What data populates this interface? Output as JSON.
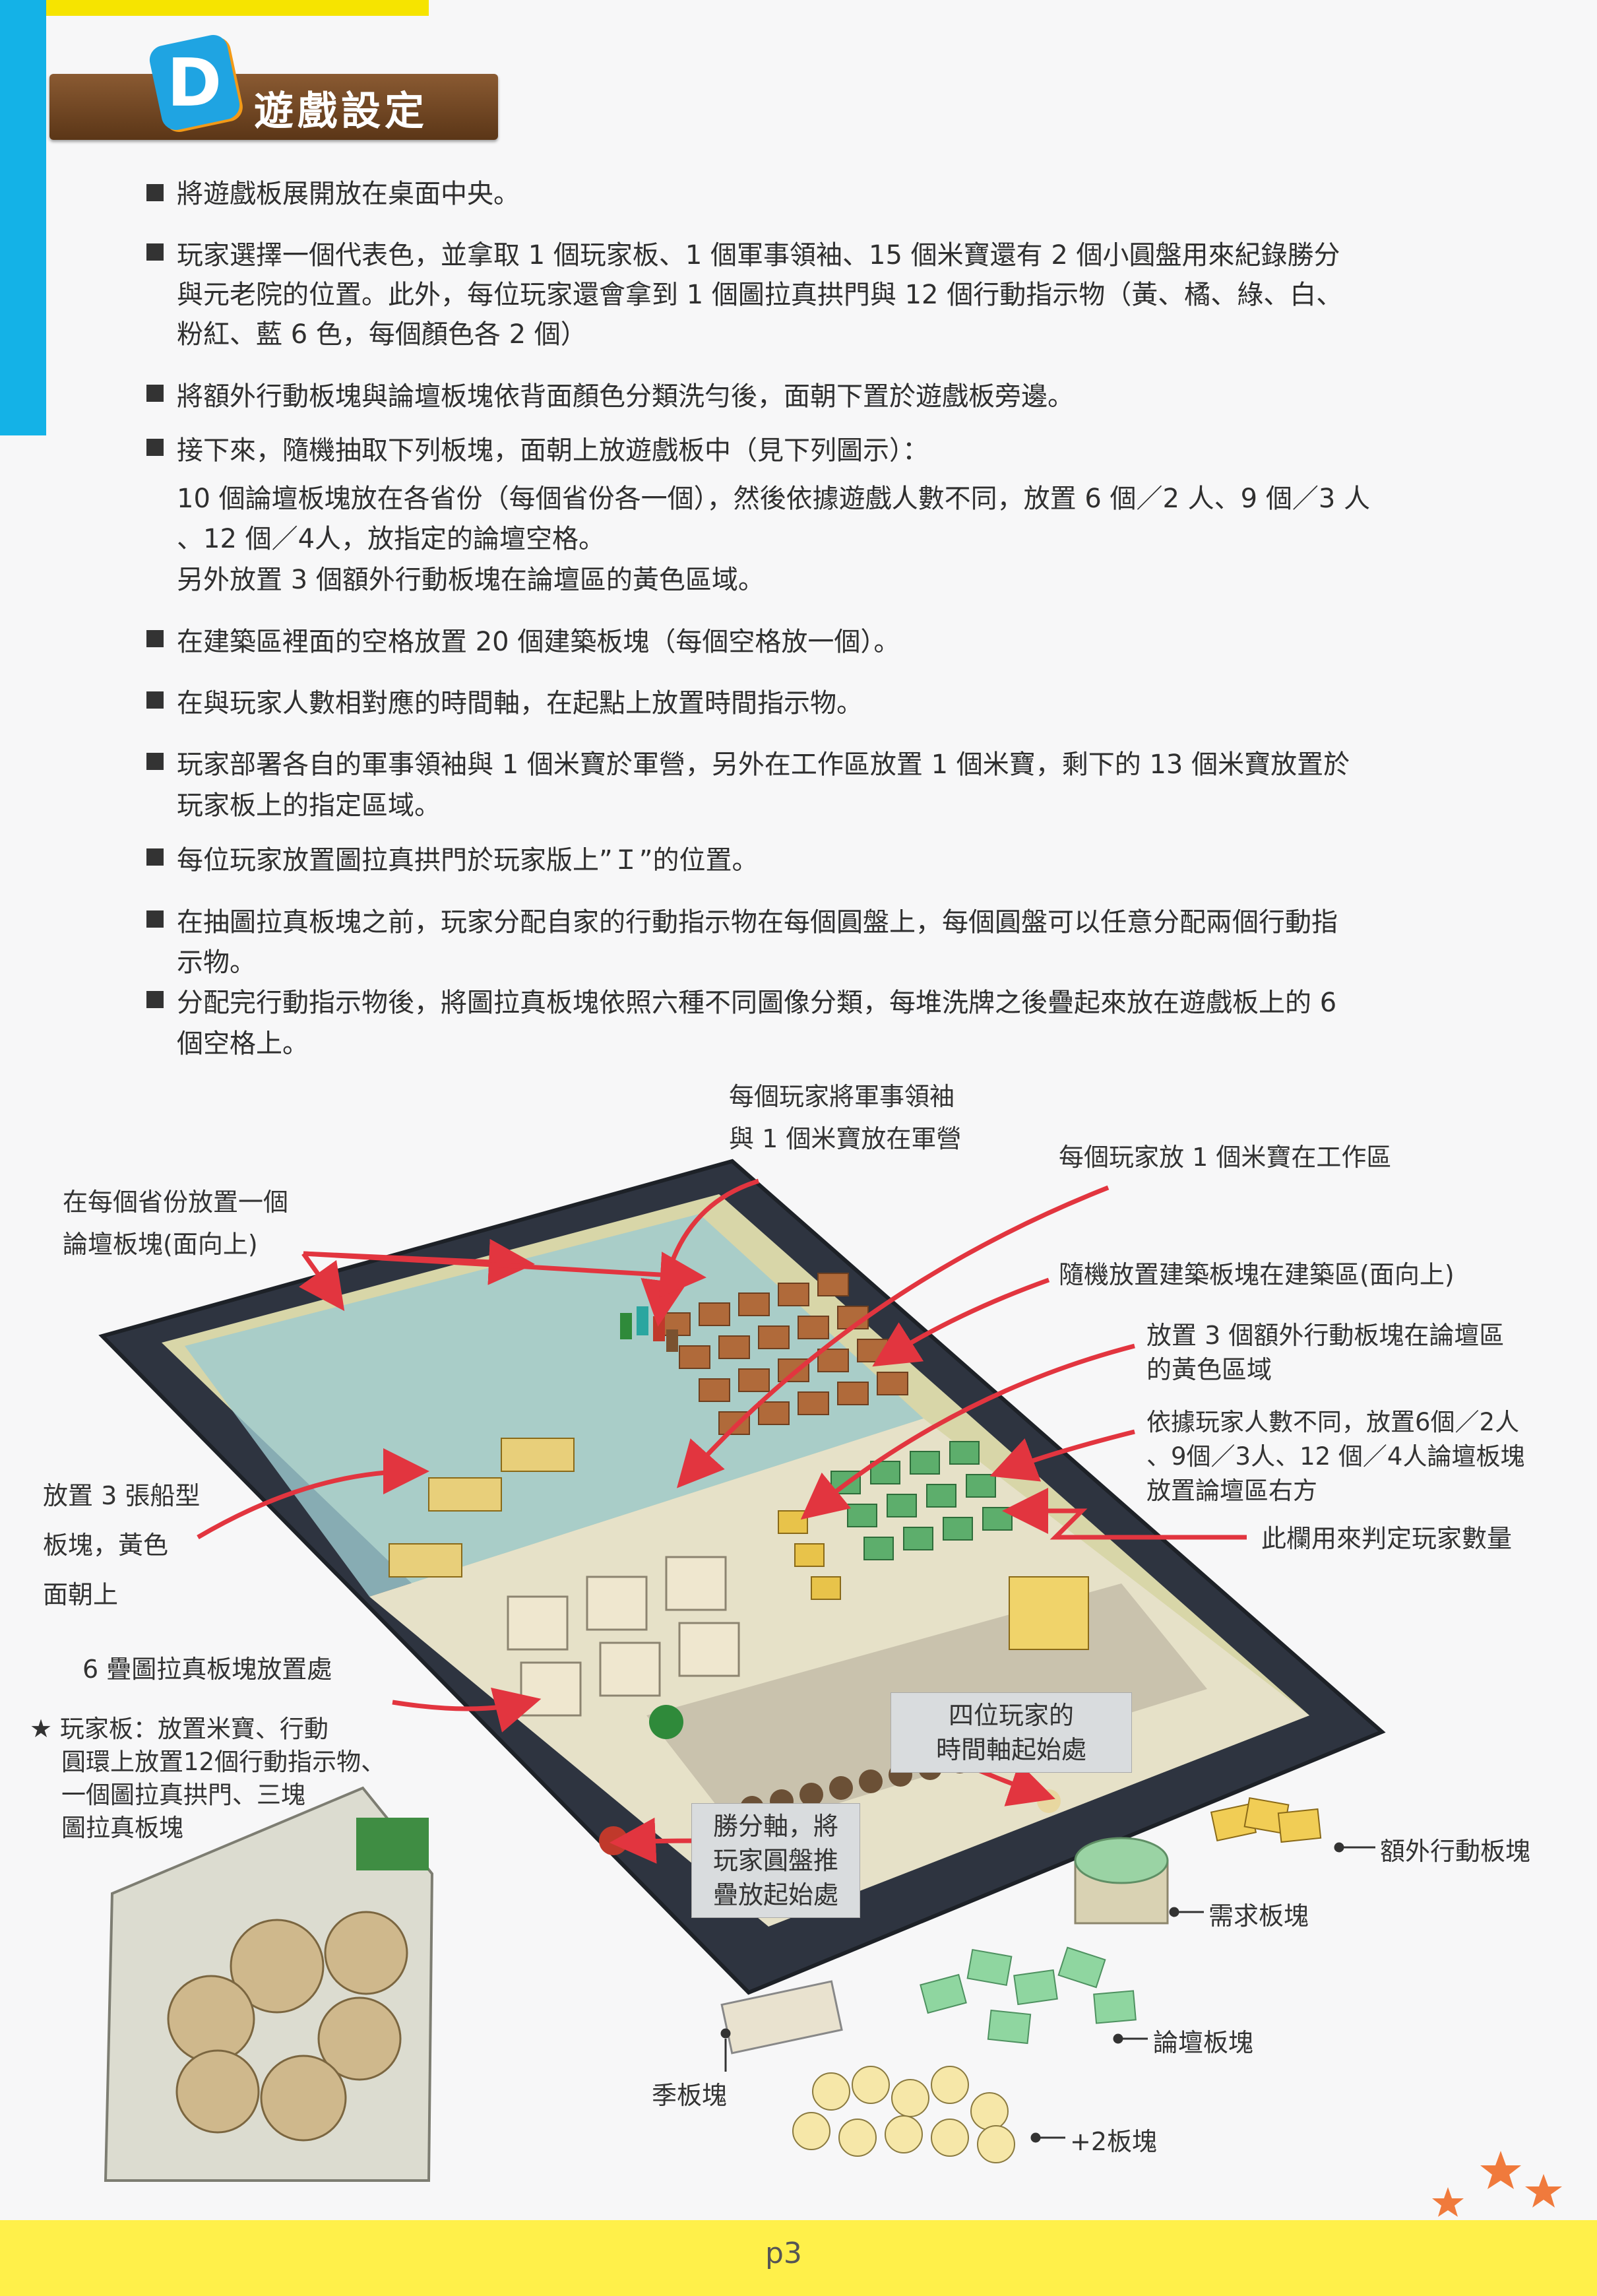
{
  "header": {
    "badge": "D",
    "title": "遊戲設定"
  },
  "bullets": [
    {
      "lines": [
        "將遊戲板展開放在桌面中央。"
      ]
    },
    {
      "lines": [
        "玩家選擇一個代表色，並拿取 1 個玩家板、1 個軍事領袖、15 個米寶還有 2 個小圓盤用來紀錄勝分",
        "與元老院的位置。此外，每位玩家還會拿到 1 個圖拉真拱門與 12 個行動指示物（黃、橘、綠、白、",
        "粉紅、藍 6 色，每個顏色各 2 個）"
      ]
    },
    {
      "lines": [
        "將額外行動板塊與論壇板塊依背面顏色分類洗勻後，面朝下置於遊戲板旁邊。"
      ]
    },
    {
      "lines": [
        "接下來，隨機抽取下列板塊，面朝上放遊戲板中（見下列圖示）：",
        "10 個論壇板塊放在各省份（每個省份各一個），然後依據遊戲人數不同，放置 6 個／2 人、9 個／3 人",
        "、12 個／4人，放指定的論壇空格。",
        "另外放置 3 個額外行動板塊在論壇區的黃色區域。"
      ]
    },
    {
      "lines": [
        "在建築區裡面的空格放置 20 個建築板塊（每個空格放一個）。"
      ]
    },
    {
      "lines": [
        "在與玩家人數相對應的時間軸，在起點上放置時間指示物。"
      ]
    },
    {
      "lines": [
        "玩家部署各自的軍事領袖與 1 個米寶於軍營，另外在工作區放置 1 個米寶，剩下的 13 個米寶放置於",
        "玩家板上的指定區域。"
      ]
    },
    {
      "lines": [
        "每位玩家放置圖拉真拱門於玩家版上”Ｉ”的位置。"
      ]
    },
    {
      "lines": [
        "在抽圖拉真板塊之前，玩家分配自家的行動指示物在每個圓盤上，每個圓盤可以任意分配兩個行動指",
        "示物。"
      ]
    },
    {
      "lines": [
        "分配完行動指示物後，將圖拉真板塊依照六種不同圖像分類，每堆洗牌之後疊起來放在遊戲板上的 6",
        "個空格上。"
      ]
    }
  ],
  "callouts": {
    "military": [
      "每個玩家將軍事領袖",
      "與 1 個米寶放在軍營"
    ],
    "worker": "每個玩家放 1 個米寶在工作區",
    "forum_province": [
      "在每個省份放置一個",
      "論壇板塊(面向上)"
    ],
    "buildings": "隨機放置建築板塊在建築區(面向上)",
    "extra_action": [
      "放置 3 個額外行動板塊在論壇區",
      "的黃色區域"
    ],
    "forum_count": [
      "依據玩家人數不同，放置6個／2人",
      "、9個／3人、12 個／4人論壇板塊",
      "放置論壇區右方"
    ],
    "player_count": "此欄用來判定玩家數量",
    "ships": [
      "放置 3 張船型",
      "板塊，黃色",
      "面朝上"
    ],
    "trajan_stacks": "6 疊圖拉真板塊放置處",
    "player_board": [
      "玩家板：放置米寶、行動",
      "圓環上放置12個行動指示物、",
      "一個圖拉真拱門、三塊",
      "圖拉真板塊"
    ],
    "time_start": [
      "四位玩家的",
      "時間軸起始處"
    ],
    "score_start": [
      "勝分軸，將",
      "玩家圓盤推",
      "疊放起始處"
    ]
  },
  "legend": {
    "extra_action": "額外行動板塊",
    "demand": "需求板塊",
    "forum": "論壇板塊",
    "season": "季板塊",
    "plus2": "+2板塊"
  },
  "footer": {
    "page": "p3"
  },
  "colors": {
    "accent_blue": "#14b2e7",
    "accent_yellow": "#f6e400",
    "arrow_red": "#e2353f",
    "header_brown": "#6e4423"
  }
}
